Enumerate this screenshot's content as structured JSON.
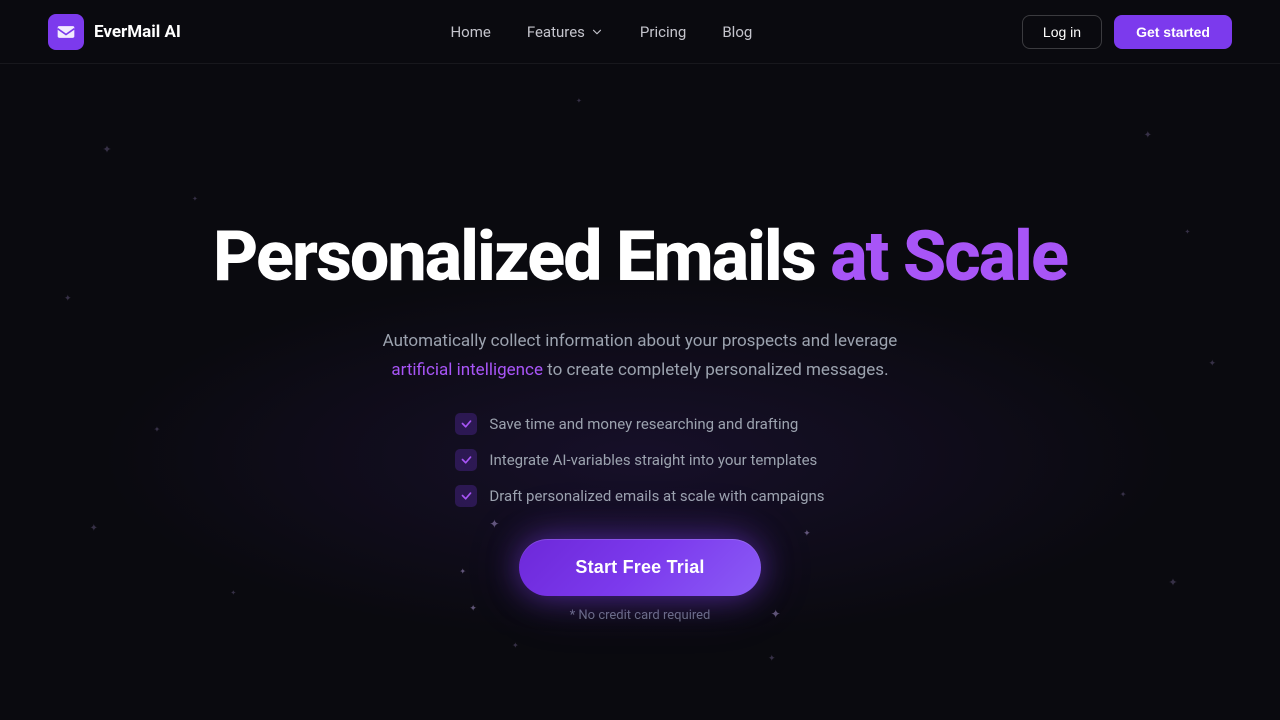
{
  "brand": {
    "name": "EverMail AI",
    "logo_icon": "mail-icon"
  },
  "nav": {
    "links": [
      {
        "label": "Home",
        "id": "home"
      },
      {
        "label": "Features",
        "id": "features",
        "has_dropdown": true
      },
      {
        "label": "Pricing",
        "id": "pricing"
      },
      {
        "label": "Blog",
        "id": "blog"
      }
    ],
    "login_label": "Log in",
    "get_started_label": "Get started"
  },
  "hero": {
    "title_white": "Personalized Emails",
    "title_purple": "at Scale",
    "subtitle_before_link": "Automatically collect information about your prospects and leverage",
    "subtitle_link": "artificial intelligence",
    "subtitle_after_link": "to create completely personalized messages.",
    "checklist": [
      "Save time and money researching and drafting",
      "Integrate AI-variables straight into your templates",
      "Draft personalized emails at scale with campaigns"
    ],
    "cta_label": "Start Free Trial",
    "no_cc_label": "* No credit card required"
  },
  "colors": {
    "purple_accent": "#a855f7",
    "purple_button": "#7c3aed",
    "text_muted": "#9ca3af"
  }
}
